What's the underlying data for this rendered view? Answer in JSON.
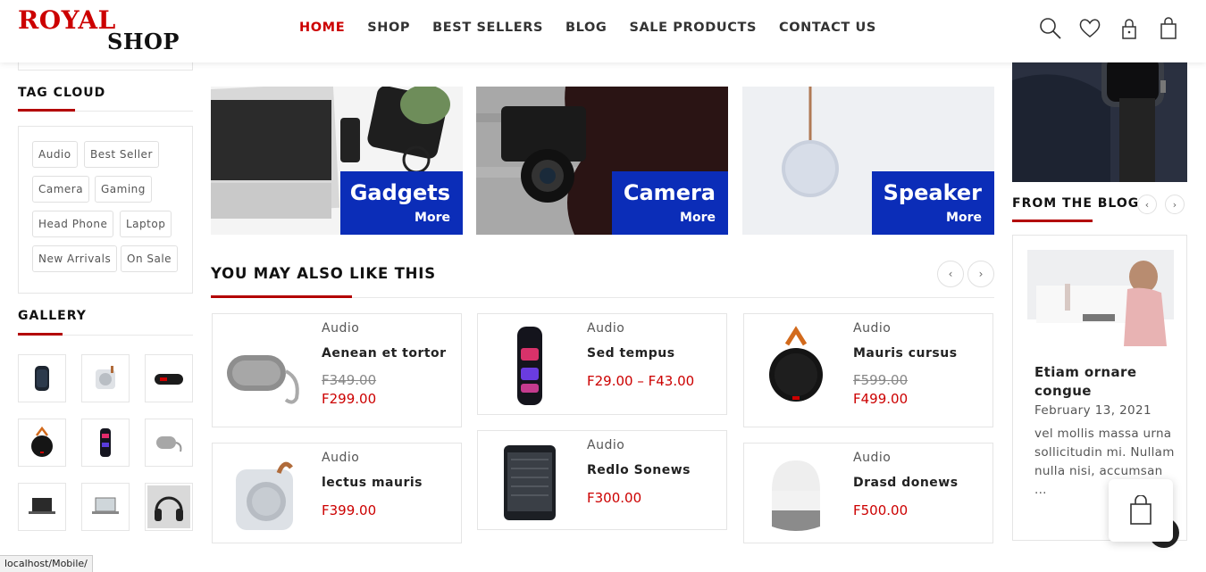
{
  "logo": {
    "line1": "ROYAL",
    "line2": "SHOP"
  },
  "nav": {
    "items": [
      {
        "label": "HOME",
        "active": true
      },
      {
        "label": "SHOP"
      },
      {
        "label": "BEST SELLERS"
      },
      {
        "label": "BLOG"
      },
      {
        "label": "SALE PRODUCTS"
      },
      {
        "label": "CONTACT US"
      }
    ]
  },
  "header_icons": [
    "search-icon",
    "heart-icon",
    "lock-icon",
    "bag-icon"
  ],
  "sidebar": {
    "tag_cloud_title": "TAG CLOUD",
    "tags": [
      "Audio",
      "Best Seller",
      "Camera",
      "Gaming",
      "Head Phone",
      "Laptop",
      "New Arrivals",
      "On Sale"
    ],
    "gallery_title": "GALLERY"
  },
  "banners": [
    {
      "title": "Gadgets",
      "more": "More"
    },
    {
      "title": "Camera",
      "more": "More"
    },
    {
      "title": "Speaker",
      "more": "More"
    }
  ],
  "section": {
    "title": "YOU MAY ALSO LIKE THIS",
    "prev": "‹",
    "next": "›"
  },
  "products": [
    {
      "category": "Audio",
      "name": "Aenean et tortor",
      "old_price": "Ϝ349.00",
      "price": "Ϝ299.00"
    },
    {
      "category": "Audio",
      "name": "Sed tempus",
      "price": "Ϝ29.00 – Ϝ43.00"
    },
    {
      "category": "Audio",
      "name": "Mauris cursus",
      "old_price": "Ϝ599.00",
      "price": "Ϝ499.00"
    },
    {
      "category": "Audio",
      "name": "lectus mauris",
      "price": "Ϝ399.00"
    },
    {
      "category": "Audio",
      "name": "Redlo Sonews",
      "price": "Ϝ300.00"
    },
    {
      "category": "Audio",
      "name": "Drasd donews",
      "price": "Ϝ500.00"
    }
  ],
  "blog": {
    "title": "FROM THE BLOG",
    "prev": "‹",
    "next": "›",
    "post_title": "Etiam ornare congue",
    "date": "February 13, 2021",
    "excerpt": "vel mollis massa urna sollicitudin mi. Nullam nulla nisi, accumsan ..."
  },
  "status_bar": "localhost/Mobile/",
  "colors": {
    "accent": "#c00000",
    "banner_blue": "#0b2db8"
  }
}
